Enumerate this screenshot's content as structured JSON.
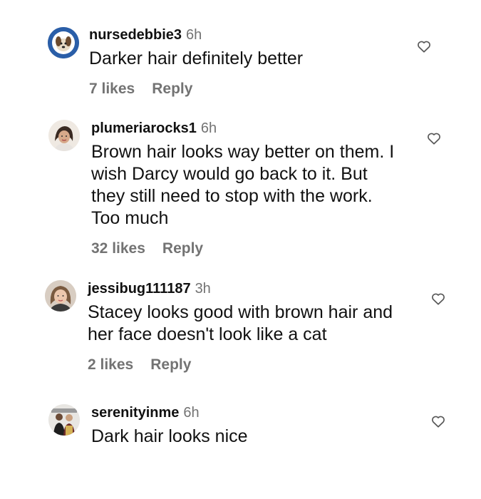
{
  "comments": [
    {
      "username": "nursedebbie3",
      "time": "6h",
      "text": "Darker hair definitely better",
      "likes": "7 likes",
      "reply": "Reply",
      "avatar_icon": "dog-avatar",
      "like_icon": "heart-outline-icon"
    },
    {
      "username": "plumeriarocks1",
      "time": "6h",
      "text": "Brown hair looks way better on them. I wish Darcy would go back to it. But they still need to stop with the work. Too much",
      "likes": "32 likes",
      "reply": "Reply",
      "avatar_icon": "user-photo-avatar",
      "like_icon": "heart-outline-icon"
    },
    {
      "username": "jessibug111187",
      "time": "3h",
      "text": "Stacey looks good with brown hair and her face doesn't look like a cat",
      "likes": "2 likes",
      "reply": "Reply",
      "avatar_icon": "user-photo-avatar",
      "like_icon": "heart-outline-icon"
    },
    {
      "username": "serenityinme",
      "time": "6h",
      "text": "Dark hair looks nice",
      "avatar_icon": "user-photo-avatar",
      "like_icon": "heart-outline-icon"
    }
  ],
  "colors": {
    "text": "#111111",
    "secondary": "#737373",
    "background": "#ffffff"
  }
}
